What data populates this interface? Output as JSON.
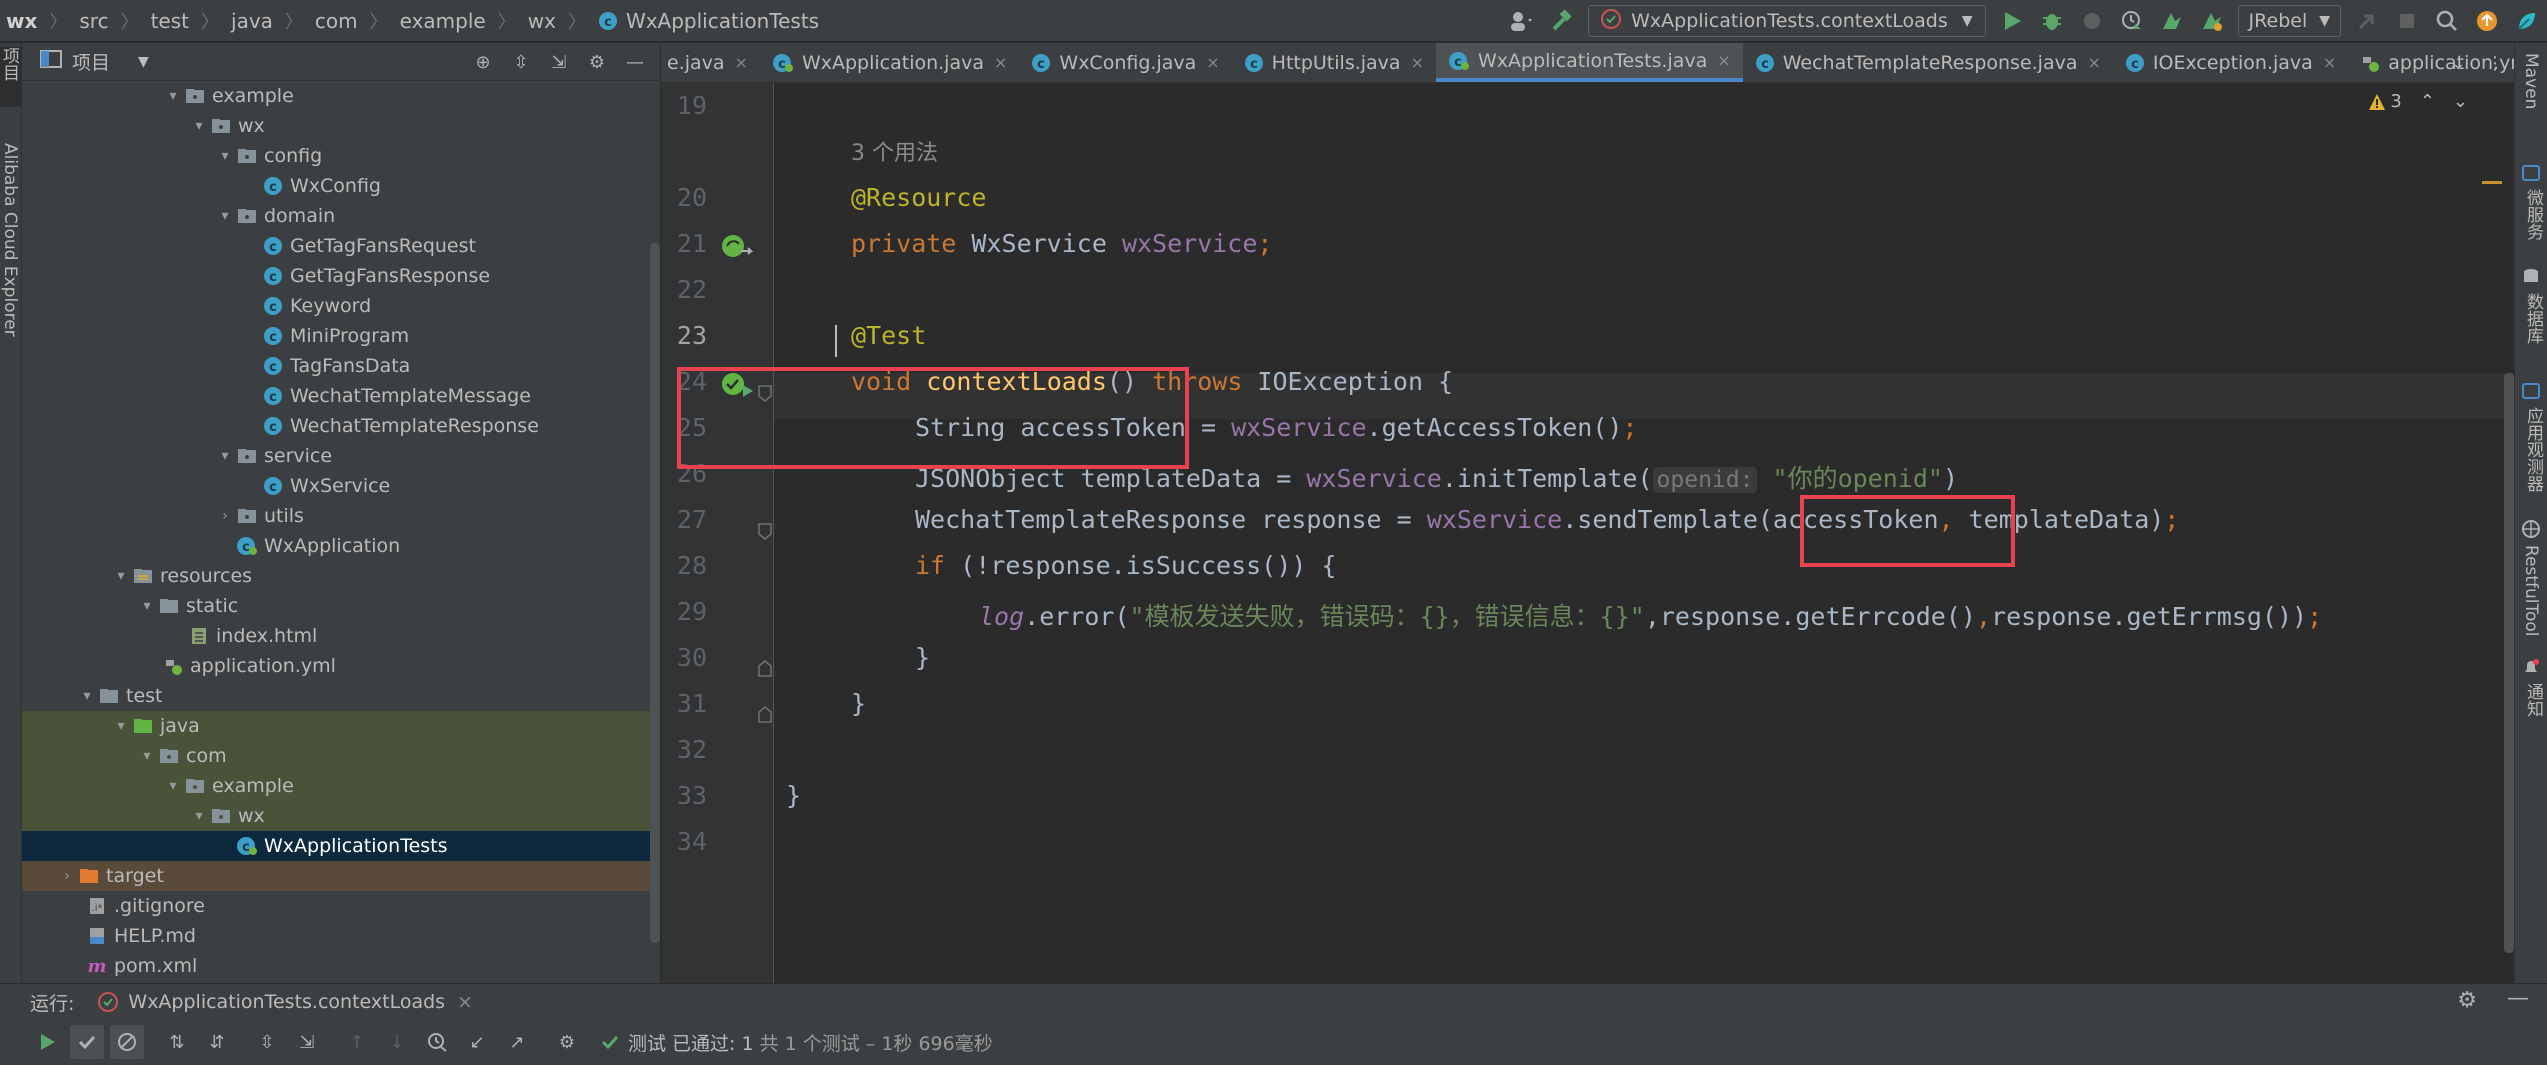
{
  "breadcrumbs": [
    "wx",
    "src",
    "test",
    "java",
    "com",
    "example",
    "wx",
    "WxApplicationTests"
  ],
  "toolbar": {
    "run_config": "WxApplicationTests.contextLoads",
    "jrebel": "JRebel"
  },
  "left_stripe": {
    "project": "项目",
    "cloud": "Alibaba Cloud Explorer"
  },
  "project_panel": {
    "title": "项目",
    "tree": [
      {
        "label": "example"
      },
      {
        "label": "wx"
      },
      {
        "label": "config"
      },
      {
        "label": "WxConfig"
      },
      {
        "label": "domain"
      },
      {
        "label": "GetTagFansRequest"
      },
      {
        "label": "GetTagFansResponse"
      },
      {
        "label": "Keyword"
      },
      {
        "label": "MiniProgram"
      },
      {
        "label": "TagFansData"
      },
      {
        "label": "WechatTemplateMessage"
      },
      {
        "label": "WechatTemplateResponse"
      },
      {
        "label": "service"
      },
      {
        "label": "WxService"
      },
      {
        "label": "utils"
      },
      {
        "label": "WxApplication"
      },
      {
        "label": "resources"
      },
      {
        "label": "static"
      },
      {
        "label": "index.html"
      },
      {
        "label": "application.yml"
      },
      {
        "label": "test"
      },
      {
        "label": "java"
      },
      {
        "label": "com"
      },
      {
        "label": "example"
      },
      {
        "label": "wx"
      },
      {
        "label": "WxApplicationTests"
      },
      {
        "label": "target"
      },
      {
        "label": ".gitignore"
      },
      {
        "label": "HELP.md"
      },
      {
        "label": "pom.xml"
      }
    ]
  },
  "editor_tabs": [
    {
      "label": "e.java"
    },
    {
      "label": "WxApplication.java"
    },
    {
      "label": "WxConfig.java"
    },
    {
      "label": "HttpUtils.java"
    },
    {
      "label": "WxApplicationTests.java"
    },
    {
      "label": "WechatTemplateResponse.java"
    },
    {
      "label": "IOException.java"
    },
    {
      "label": "application.yml"
    }
  ],
  "inspection": {
    "warnings": "3"
  },
  "code": {
    "line_numbers": [
      "19",
      "20",
      "21",
      "22",
      "23",
      "24",
      "25",
      "26",
      "27",
      "28",
      "29",
      "30",
      "31",
      "32",
      "33",
      "34"
    ],
    "usages": "3 个用法",
    "l20": "@Resource",
    "l21_kw": "private",
    "l21_type": " WxService ",
    "l21_field": "wxService",
    "l21_end": ";",
    "l23": "@Test",
    "l24_kw": "void",
    "l24_fn": "contextLoads",
    "l24_mid": "() ",
    "l24_throws": "throws",
    "l24_end": " IOException {",
    "l25_a": "String accessToken = ",
    "l25_f": "wxService",
    "l25_b": ".getAccessToken()",
    "l25_c": ";",
    "l26_a": "JSONObject templateData = ",
    "l26_f": "wxService",
    "l26_b": ".initTemplate(",
    "l26_hint": "openid:",
    "l26_str": "\"你的openid\"",
    "l26_c": ")",
    "l27_a": "WechatTemplateResponse response = ",
    "l27_f": "wxService",
    "l27_b": ".sendTemplate(accessToken",
    "l27_comma": ",",
    "l27_c": " templateData)",
    "l27_semi": ";",
    "l28_kw": "if",
    "l28_b": " (!response.isSuccess()) {",
    "l29_log": "log",
    "l29_a": ".error(",
    "l29_str": "\"模板发送失败，错误码：{}，错误信息：{}\"",
    "l29_b": ",response.getErrcode()",
    "l29_comma": ",",
    "l29_c": "response.getErrmsg())",
    "l29_semi": ";",
    "l30": "}",
    "l31": "}",
    "l33": "}"
  },
  "right_stripe": [
    "Maven",
    "微服务",
    "数据库",
    "应用观测器",
    "RestfulTool",
    "通知"
  ],
  "run_panel": {
    "label": "运行:",
    "tab": "WxApplicationTests.contextLoads",
    "status_main": "测试 已通过: 1",
    "status_detail": "共 1 个测试 – 1秒 696毫秒"
  }
}
